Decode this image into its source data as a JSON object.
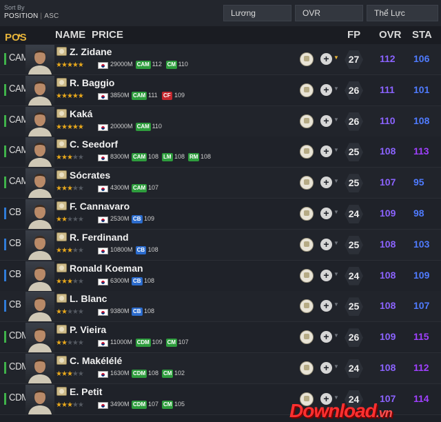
{
  "sort": {
    "label": "Sort By",
    "field": "POSITION",
    "direction": "ASC"
  },
  "filters": [
    "Lương",
    "OVR",
    "Thể Lực"
  ],
  "columns": {
    "pos": "POS",
    "name": "NAME",
    "price": "PRICE",
    "fp": "FP",
    "ovr": "OVR",
    "sta": "STA"
  },
  "colors": {
    "cam_bar": "#3fb24a",
    "cb_bar": "#2f7bd8",
    "cdm_bar": "#3fb24a",
    "chip_green": "#2e9d3d",
    "chip_blue": "#2b6bcc",
    "chip_red": "#c2272d",
    "ovr": "#8b63ff",
    "sta_blue": "#4f7bff",
    "sta_purple": "#a040ff"
  },
  "players": [
    {
      "pos": "CAM",
      "name": "Z. Zidane",
      "stars": 5,
      "price": "29000M",
      "chips": [
        {
          "pos": "CAM",
          "val": "112",
          "color": "green"
        },
        {
          "pos": "CM",
          "val": "110",
          "color": "green"
        }
      ],
      "fp": "27",
      "ovr": "112",
      "sta": "106",
      "sta_color": "blue"
    },
    {
      "pos": "CAM",
      "name": "R. Baggio",
      "stars": 5,
      "price": "3850M",
      "chips": [
        {
          "pos": "CAM",
          "val": "111",
          "color": "green"
        },
        {
          "pos": "CF",
          "val": "109",
          "color": "red"
        }
      ],
      "fp": "26",
      "ovr": "111",
      "sta": "101",
      "sta_color": "blue"
    },
    {
      "pos": "CAM",
      "name": "Kaká",
      "stars": 5,
      "price": "20000M",
      "chips": [
        {
          "pos": "CAM",
          "val": "110",
          "color": "green"
        }
      ],
      "fp": "26",
      "ovr": "110",
      "sta": "108",
      "sta_color": "blue"
    },
    {
      "pos": "CAM",
      "name": "C. Seedorf",
      "stars": 3,
      "price": "8300M",
      "chips": [
        {
          "pos": "CAM",
          "val": "108",
          "color": "green"
        },
        {
          "pos": "LM",
          "val": "108",
          "color": "green"
        },
        {
          "pos": "RM",
          "val": "108",
          "color": "green"
        }
      ],
      "fp": "25",
      "ovr": "108",
      "sta": "113",
      "sta_color": "purple"
    },
    {
      "pos": "CAM",
      "name": "Sócrates",
      "stars": 3,
      "price": "4300M",
      "chips": [
        {
          "pos": "CAM",
          "val": "107",
          "color": "green"
        }
      ],
      "fp": "25",
      "ovr": "107",
      "sta": "95",
      "sta_color": "blue"
    },
    {
      "pos": "CB",
      "name": "F. Cannavaro",
      "stars": 2,
      "price": "2530M",
      "chips": [
        {
          "pos": "CB",
          "val": "109",
          "color": "blue"
        }
      ],
      "fp": "24",
      "ovr": "109",
      "sta": "98",
      "sta_color": "blue"
    },
    {
      "pos": "CB",
      "name": "R. Ferdinand",
      "stars": 3,
      "price": "10800M",
      "chips": [
        {
          "pos": "CB",
          "val": "108",
          "color": "blue"
        }
      ],
      "fp": "25",
      "ovr": "108",
      "sta": "103",
      "sta_color": "blue"
    },
    {
      "pos": "CB",
      "name": "Ronald Koeman",
      "stars": 3,
      "price": "6300M",
      "chips": [
        {
          "pos": "CB",
          "val": "108",
          "color": "blue"
        }
      ],
      "fp": "24",
      "ovr": "108",
      "sta": "109",
      "sta_color": "blue"
    },
    {
      "pos": "CB",
      "name": "L. Blanc",
      "stars": 2,
      "price": "9380M",
      "chips": [
        {
          "pos": "CB",
          "val": "108",
          "color": "blue"
        }
      ],
      "fp": "25",
      "ovr": "108",
      "sta": "107",
      "sta_color": "blue"
    },
    {
      "pos": "CDM",
      "name": "P. Vieira",
      "stars": 2,
      "price": "11000M",
      "chips": [
        {
          "pos": "CDM",
          "val": "109",
          "color": "green"
        },
        {
          "pos": "CM",
          "val": "107",
          "color": "green"
        }
      ],
      "fp": "26",
      "ovr": "109",
      "sta": "115",
      "sta_color": "purple"
    },
    {
      "pos": "CDM",
      "name": "C. Makélélé",
      "stars": 3,
      "price": "1630M",
      "chips": [
        {
          "pos": "CDM",
          "val": "108",
          "color": "green"
        },
        {
          "pos": "CM",
          "val": "102",
          "color": "green"
        }
      ],
      "fp": "24",
      "ovr": "108",
      "sta": "112",
      "sta_color": "purple"
    },
    {
      "pos": "CDM",
      "name": "E. Petit",
      "stars": 3,
      "price": "3490M",
      "chips": [
        {
          "pos": "CDM",
          "val": "107",
          "color": "green"
        },
        {
          "pos": "CM",
          "val": "105",
          "color": "green"
        }
      ],
      "fp": "24",
      "ovr": "107",
      "sta": "114",
      "sta_color": "purple"
    }
  ],
  "watermark": {
    "main": "Download",
    "suffix": ".vn"
  }
}
